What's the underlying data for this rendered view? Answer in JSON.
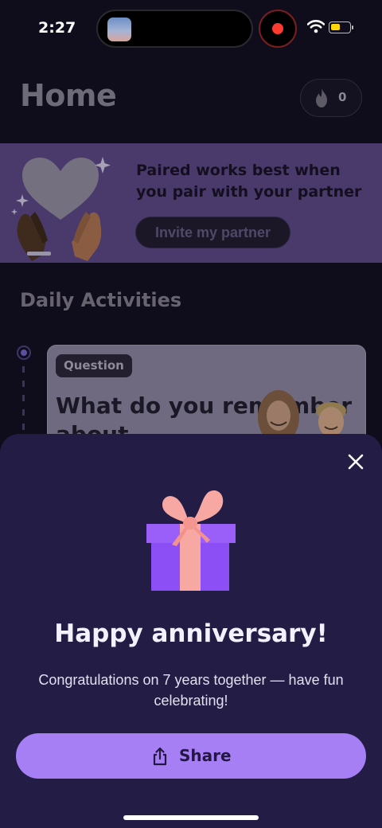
{
  "status_bar": {
    "time": "2:27",
    "icons": [
      "screen-recording-icon",
      "wifi-icon",
      "battery-icon"
    ],
    "battery_level": 0.45
  },
  "header": {
    "title": "Home",
    "streak_count": "0",
    "streak_icon": "flame-icon"
  },
  "banner": {
    "text": "Paired works best when you pair with your partner",
    "button_label": "Invite my partner"
  },
  "daily_activities": {
    "section_title": "Daily Activities",
    "card": {
      "tag": "Question",
      "title": "What do you remember about"
    }
  },
  "sheet": {
    "close_icon": "close-icon",
    "gift_icon": "gift-icon",
    "title": "Happy anniversary!",
    "subtitle": "Congratulations on 7 years together — have fun celebrating!",
    "share_label": "Share",
    "share_icon": "share-icon"
  },
  "colors": {
    "sheet_background": "#231d45",
    "share_button": "#a77ff5",
    "banner_background": "#4a3a6b",
    "gift_box": "#8b4ff5",
    "gift_ribbon": "#f7a8a3"
  }
}
